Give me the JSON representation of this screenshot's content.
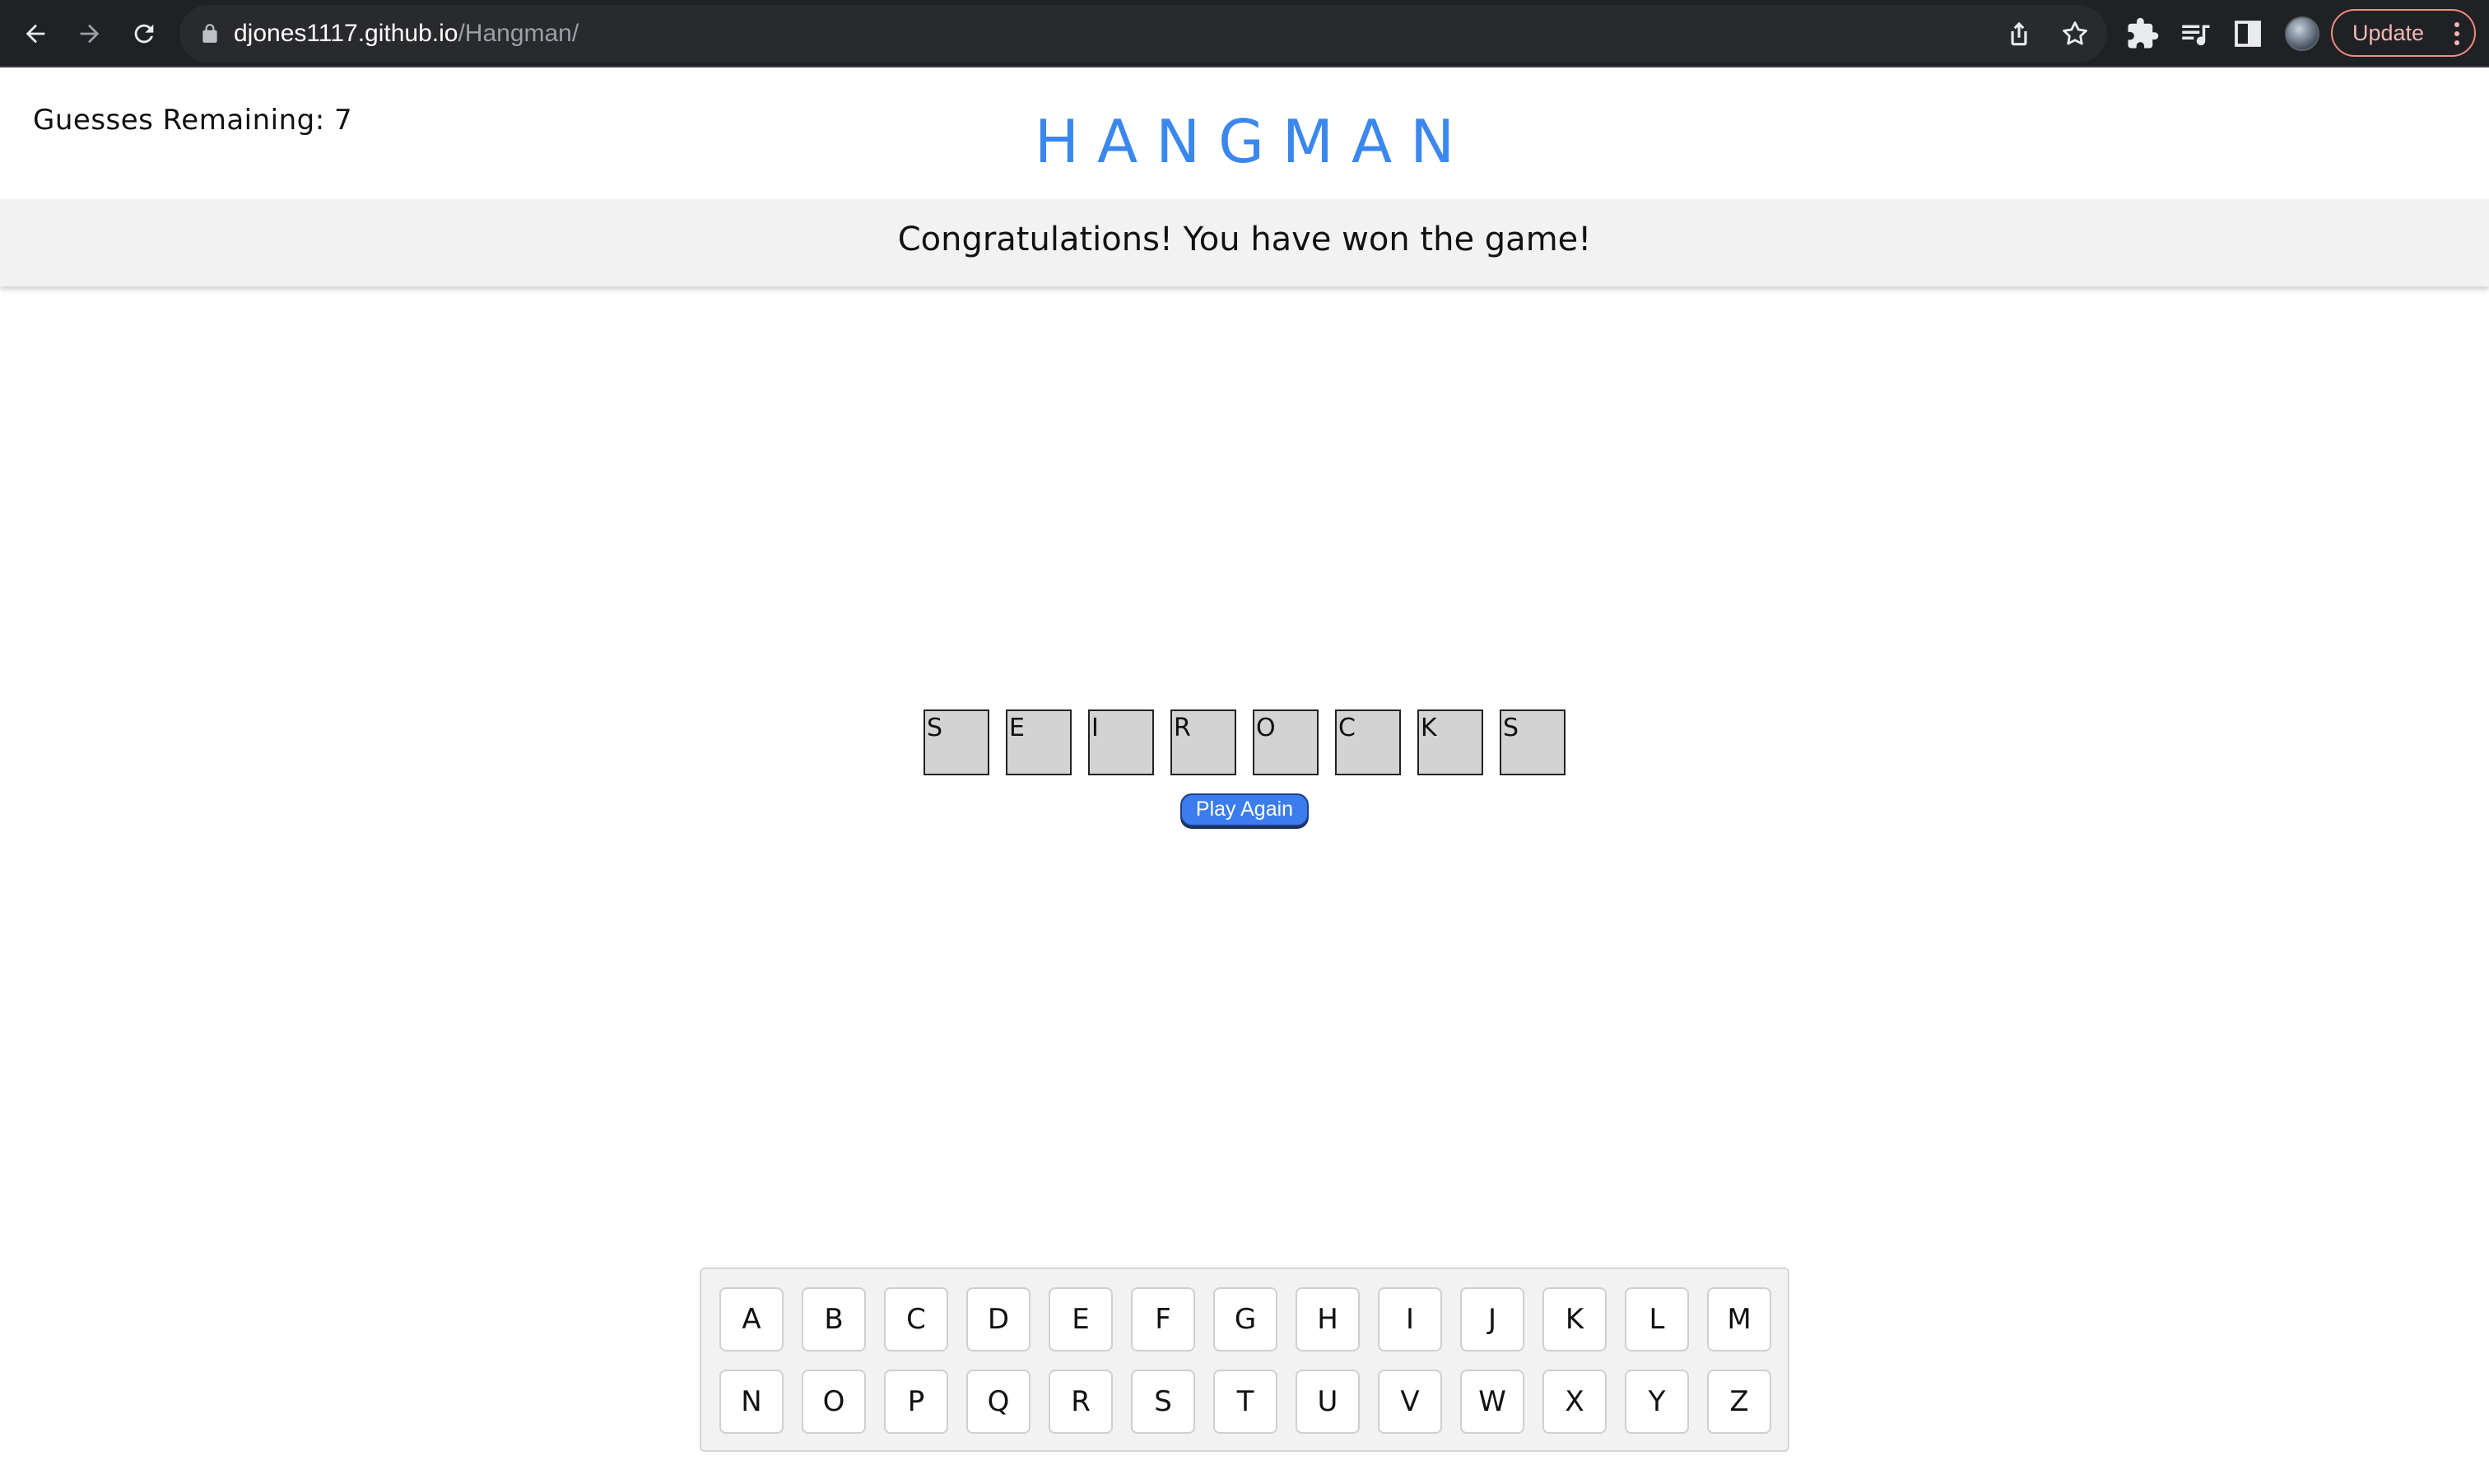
{
  "browser": {
    "url_host": "djones1117.github.io",
    "url_path": "/Hangman/",
    "update_label": "Update",
    "icons": [
      "back-arrow-icon",
      "forward-arrow-icon",
      "reload-icon",
      "lock-icon",
      "share-icon",
      "star-icon",
      "extensions-icon",
      "media-control-icon",
      "side-panel-icon",
      "profile-avatar",
      "more-vert-icon"
    ]
  },
  "game": {
    "guesses_label": "Guesses Remaining: 7",
    "title": "HANGMAN",
    "status_message": "Congratulations! You have won the game!",
    "word_letters": [
      "S",
      "E",
      "I",
      "R",
      "O",
      "C",
      "K",
      "S"
    ],
    "play_again_label": "Play Again"
  },
  "keyboard": {
    "row1": [
      "A",
      "B",
      "C",
      "D",
      "E",
      "F",
      "G",
      "H",
      "I",
      "J",
      "K",
      "L",
      "M"
    ],
    "row2": [
      "N",
      "O",
      "P",
      "Q",
      "R",
      "S",
      "T",
      "U",
      "V",
      "W",
      "X",
      "Y",
      "Z"
    ]
  },
  "colors": {
    "title": "#3a88ee",
    "banner_bg": "#f2f2f2",
    "tile_bg": "#d3d3d3",
    "play_again_bg": "#3b7ded",
    "update_border": "#f28b82"
  }
}
